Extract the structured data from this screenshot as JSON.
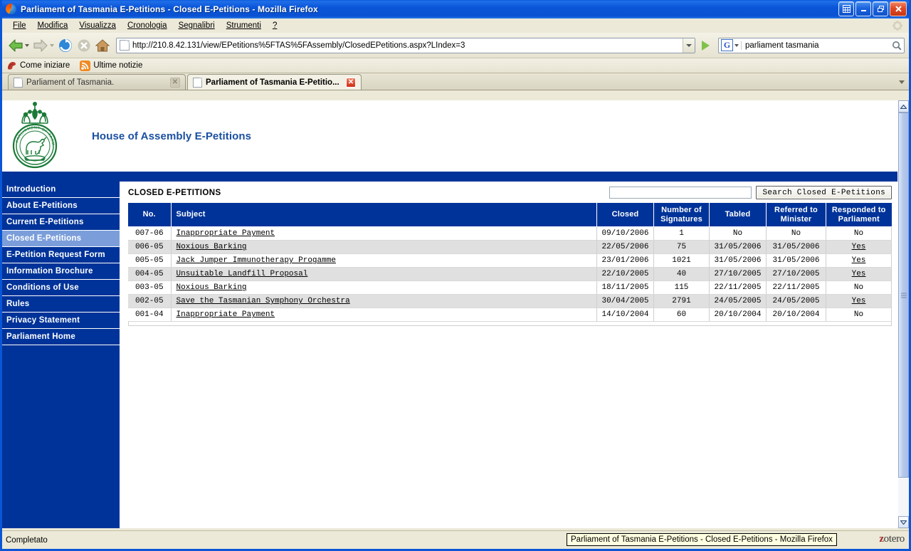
{
  "window": {
    "title": "Parliament of Tasmania E-Petitions - Closed E-Petitions - Mozilla Firefox",
    "app_icon": "firefox-icon",
    "buttons": {
      "restore_all": "▦",
      "minimize": "_",
      "maximize": "❐",
      "close": "✕"
    }
  },
  "menubar": {
    "items": [
      {
        "label": "File"
      },
      {
        "label": "Modifica"
      },
      {
        "label": "Visualizza"
      },
      {
        "label": "Cronologia"
      },
      {
        "label": "Segnalibri"
      },
      {
        "label": "Strumenti"
      },
      {
        "label": "?"
      }
    ]
  },
  "toolbar": {
    "back_title": "Indietro",
    "forward_title": "Avanti",
    "reload_title": "Ricarica",
    "stop_title": "Interrompi",
    "home_title": "Pagina iniziale",
    "url": "http://210.8.42.131/view/EPetitions%5FTAS%5FAssembly/ClosedEPetitions.aspx?LIndex=3",
    "url_placeholder": "",
    "go_title": "Vai",
    "search_engine": "G",
    "search_value": "parliament tasmania",
    "search_placeholder": ""
  },
  "bookmarks": {
    "items": [
      {
        "label": "Come iniziare",
        "icon": "firefox-bookmark-icon"
      },
      {
        "label": "Ultime notizie",
        "icon": "rss-feed-icon"
      }
    ]
  },
  "tabs": [
    {
      "label": "Parliament of Tasmania.",
      "active": false
    },
    {
      "label": "Parliament of Tasmania E-Petitio...",
      "active": true
    }
  ],
  "site": {
    "logo_alt": "Parliament of Tasmania coat of arms",
    "logo_motto": "PARLIAMENT OF TASMANIA",
    "title": "House of Assembly E-Petitions"
  },
  "sidebar": {
    "items": [
      {
        "label": "Introduction",
        "active": false
      },
      {
        "label": "About E-Petitions",
        "active": false
      },
      {
        "label": "Current E-Petitions",
        "active": false
      },
      {
        "label": "Closed E-Petitions",
        "active": true
      },
      {
        "label": "E-Petition Request Form",
        "active": false
      },
      {
        "label": "Information Brochure",
        "active": false
      },
      {
        "label": "Conditions of Use",
        "active": false
      },
      {
        "label": "Rules",
        "active": false
      },
      {
        "label": "Privacy Statement",
        "active": false
      },
      {
        "label": "Parliament Home",
        "active": false
      }
    ]
  },
  "main": {
    "heading": "CLOSED E-PETITIONS",
    "search_value": "",
    "search_placeholder": "",
    "search_button": "Search Closed E-Petitions",
    "table": {
      "columns": [
        "No.",
        "Subject",
        "Closed",
        "Number of Signatures",
        "Tabled",
        "Referred to Minister",
        "Responded to Parliament"
      ],
      "columns_multiline": [
        {
          "line1": "No.",
          "line2": ""
        },
        {
          "line1": "Subject",
          "line2": ""
        },
        {
          "line1": "Closed",
          "line2": ""
        },
        {
          "line1": "Number of",
          "line2": "Signatures"
        },
        {
          "line1": "Tabled",
          "line2": ""
        },
        {
          "line1": "Referred to",
          "line2": "Minister"
        },
        {
          "line1": "Responded to",
          "line2": "Parliament"
        }
      ],
      "rows": [
        {
          "no": "007-06",
          "subject": "Inappropriate Payment",
          "subject_link": true,
          "closed": "09/10/2006",
          "signatures": "1",
          "tabled": "No",
          "referred": "No",
          "responded": "No",
          "responded_link": false
        },
        {
          "no": "006-05",
          "subject": "Noxious Barking",
          "subject_link": true,
          "closed": "22/05/2006",
          "signatures": "75",
          "tabled": "31/05/2006",
          "referred": "31/05/2006",
          "responded": "Yes",
          "responded_link": true
        },
        {
          "no": "005-05",
          "subject": "Jack Jumper Immunotherapy Progamme",
          "subject_link": true,
          "closed": "23/01/2006",
          "signatures": "1021",
          "tabled": "31/05/2006",
          "referred": "31/05/2006",
          "responded": "Yes",
          "responded_link": true
        },
        {
          "no": "004-05",
          "subject": "Unsuitable Landfill Proposal",
          "subject_link": true,
          "closed": "22/10/2005",
          "signatures": "40",
          "tabled": "27/10/2005",
          "referred": "27/10/2005",
          "responded": "Yes",
          "responded_link": true
        },
        {
          "no": "003-05",
          "subject": "Noxious Barking",
          "subject_link": true,
          "closed": "18/11/2005",
          "signatures": "115",
          "tabled": "22/11/2005",
          "referred": "22/11/2005",
          "responded": "No",
          "responded_link": false
        },
        {
          "no": "002-05",
          "subject": "Save the Tasmanian Symphony Orchestra",
          "subject_link": true,
          "closed": "30/04/2005",
          "signatures": "2791",
          "tabled": "24/05/2005",
          "referred": "24/05/2005",
          "responded": "Yes",
          "responded_link": true
        },
        {
          "no": "001-04",
          "subject": "Inappropriate Payment",
          "subject_link": true,
          "closed": "14/10/2004",
          "signatures": "60",
          "tabled": "20/10/2004",
          "referred": "20/10/2004",
          "responded": "No",
          "responded_link": false
        }
      ]
    }
  },
  "statusbar": {
    "text": "Completato",
    "tooltip": "Parliament of Tasmania E-Petitions - Closed E-Petitions - Mozilla Firefox",
    "zotero_label": "zotero"
  },
  "colors": {
    "brand_blue": "#003399",
    "title_blue": "#1a4fa0",
    "sidebar_active": "#7b9edb",
    "crest_green": "#1a7a37",
    "row_alt": "#e0e0e0",
    "chrome_beige": "#ece9d8"
  }
}
